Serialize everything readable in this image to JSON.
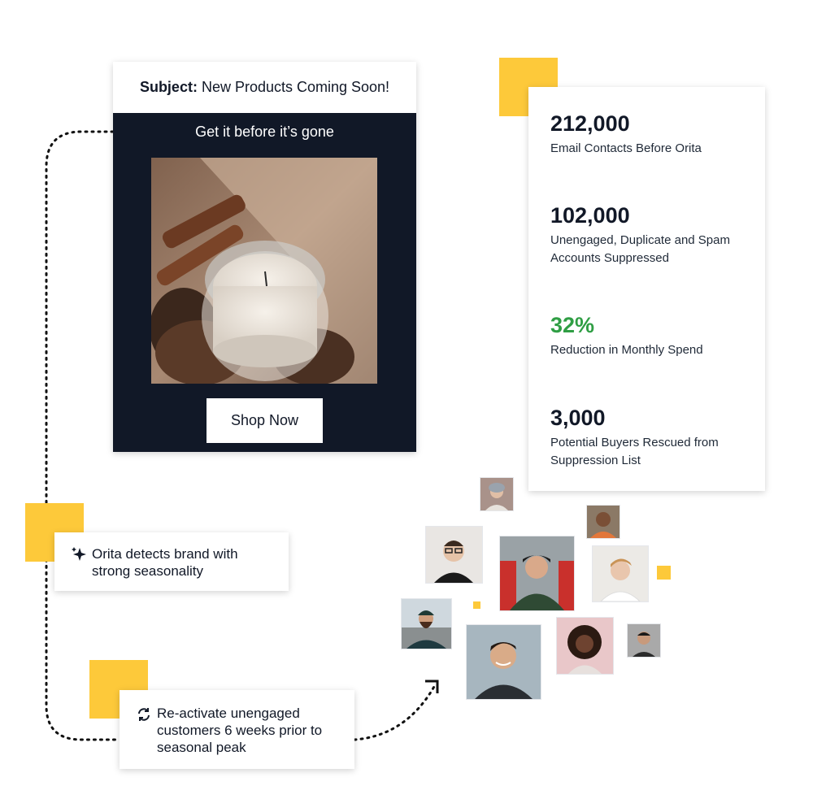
{
  "email": {
    "subject_label": "Subject:",
    "subject_text": "New Products Coming Soon!",
    "tagline": "Get it before it’s gone",
    "product_image": "candle-with-pinecones-photo",
    "cta_label": "Shop Now"
  },
  "stats": [
    {
      "value": "212,000",
      "label": "Email Contacts Before Orita"
    },
    {
      "value": "102,000",
      "label": "Unengaged, Duplicate and Spam Accounts Suppressed"
    },
    {
      "value": "32%",
      "label": "Reduction in Monthly Spend"
    },
    {
      "value": "3,000",
      "label": "Potential Buyers Rescued from Suppression List"
    }
  ],
  "callouts": {
    "detect": {
      "icon": "sparkles-icon",
      "text": "Orita detects brand with strong seasonality"
    },
    "reactivate": {
      "icon": "refresh-icon",
      "text": "Re-activate unengaged customers 6 weeks prior to seasonal peak"
    }
  },
  "colors": {
    "accent_yellow": "#fdc93a",
    "email_bg": "#111827",
    "highlight_green": "#2f9e44"
  }
}
